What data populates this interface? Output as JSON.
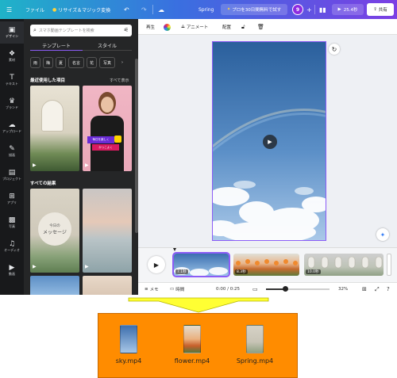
{
  "topbar": {
    "menu_icon": "hamburger-icon",
    "file_label": "ファイル",
    "magic_label": "リサイズ＆マジック変換",
    "undo_icon": "undo-icon",
    "redo_icon": "redo-icon",
    "cloud_icon": "cloud-icon",
    "doc_title": "Spring",
    "pro_label": "プロを30日間無料で試す",
    "avatar_badge": "9",
    "plus_icon": "plus-icon",
    "stats_icon": "chart-icon",
    "play_label": "25.4秒",
    "share_label": "共有"
  },
  "rail": {
    "items": [
      {
        "icon": "▣",
        "label": "デザイン"
      },
      {
        "icon": "❖",
        "label": "素材"
      },
      {
        "icon": "T",
        "label": "テキスト"
      },
      {
        "icon": "♛",
        "label": "ブランド"
      },
      {
        "icon": "☁",
        "label": "アップロード"
      },
      {
        "icon": "✎",
        "label": "描画"
      },
      {
        "icon": "▤",
        "label": "プロジェクト"
      },
      {
        "icon": "⊞",
        "label": "アプリ"
      },
      {
        "icon": "▩",
        "label": "写真"
      },
      {
        "icon": "♫",
        "label": "オーディオ"
      },
      {
        "icon": "▶",
        "label": "動画"
      }
    ]
  },
  "panel": {
    "search_placeholder": "スマホ動画テンプレートを検索",
    "tabs": [
      "テンプレート",
      "スタイル"
    ],
    "chips": [
      "雨",
      "梅",
      "夏",
      "名言",
      "花",
      "写真"
    ],
    "recent_title": "最近使用した項目",
    "recent_link": "すべて表示",
    "recent_shirt_text_1": "毎日を楽しく",
    "recent_shirt_text_2": "かっこよく",
    "all_title": "すべての結果",
    "card_text_small": "今日の",
    "card_text_big": "メッセージ"
  },
  "toolbar2": {
    "playback_label": "再生",
    "animate_label": "アニメート",
    "position_label": "配置"
  },
  "timeline": {
    "clips": [
      {
        "duration": "7.1秒"
      },
      {
        "duration": "8.3秒"
      },
      {
        "duration": "10.0秒"
      }
    ]
  },
  "statusbar": {
    "notes_label": "メモ",
    "time_label": "時間",
    "time_value": "0:00 / 0:25",
    "zoom": "32%",
    "zoom_fraction": 0.3
  },
  "files": [
    {
      "name": "sky.mp4"
    },
    {
      "name": "flower.mp4"
    },
    {
      "name": "Spring.mp4"
    }
  ],
  "colors": {
    "accent": "#8b5cf6",
    "box": "#ff8c00",
    "arrow": "#ffff00"
  }
}
